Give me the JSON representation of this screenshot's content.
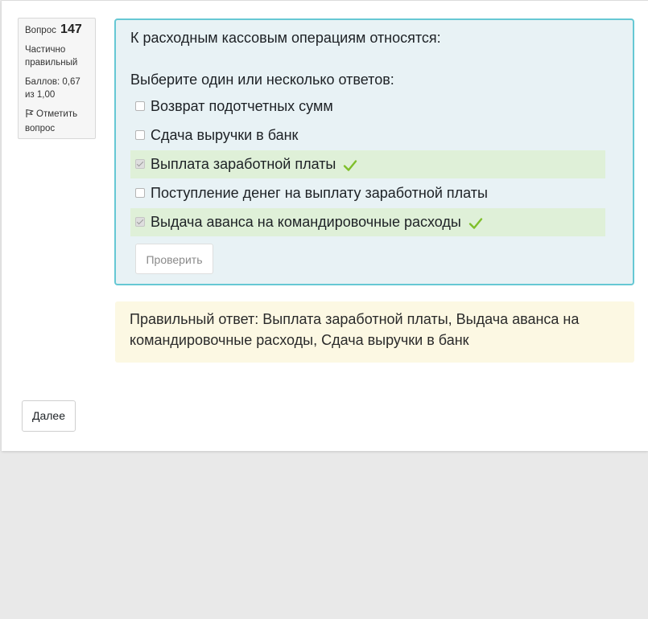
{
  "question_info": {
    "label": "Вопрос",
    "number": "147",
    "state": "Частично правильный",
    "grade": "Баллов: 0,67 из 1,00",
    "flag_label": "Отметить вопрос",
    "flag_icon": "flag-icon"
  },
  "question": {
    "text": "К расходным кассовым операциям относятся:",
    "prompt": "Выберите один или несколько ответов:",
    "options": [
      {
        "label": "Возврат подотчетных сумм",
        "checked": false,
        "correct_mark": false
      },
      {
        "label": "Сдача выручки в банк",
        "checked": false,
        "correct_mark": false
      },
      {
        "label": "Выплата заработной платы",
        "checked": true,
        "correct_mark": true
      },
      {
        "label": "Поступление денег на выплату заработной платы",
        "checked": false,
        "correct_mark": false
      },
      {
        "label": "Выдача аванса на командировочные расходы",
        "checked": true,
        "correct_mark": true
      }
    ],
    "check_button": "Проверить",
    "correct_icon": "checkmark-icon"
  },
  "feedback": {
    "right_answer": "Правильный ответ: Выплата заработной платы, Выдача аванса на командировочные расходы, Сдача выручки в банк"
  },
  "navigation": {
    "next_button": "Далее"
  },
  "colors": {
    "formulation_bg": "#e8f2f5",
    "formulation_border": "#66c8d4",
    "correct_bg": "#dff0d8",
    "check_mark": "#7fbf2a",
    "feedback_bg": "#fcf8e3"
  }
}
